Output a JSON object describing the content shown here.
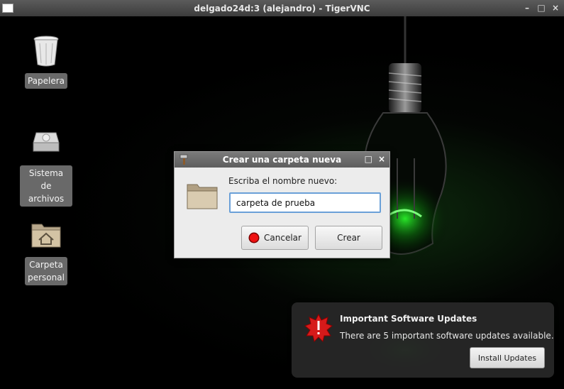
{
  "window": {
    "title": "delgado24d:3 (alejandro) - TigerVNC",
    "buttons": [
      "–",
      "□",
      "×"
    ]
  },
  "desktop_icons": [
    {
      "label": "Papelera",
      "icon": "trash-icon"
    },
    {
      "label": "Sistema de archivos",
      "icon": "drive-icon"
    },
    {
      "label": "Carpeta personal",
      "icon": "home-folder-icon"
    }
  ],
  "dialog": {
    "title": "Crear una carpeta nueva",
    "buttons": [
      "□",
      "×"
    ],
    "prompt": "Escriba el nombre nuevo:",
    "input_value": "carpeta de prueba",
    "cancel_label": "Cancelar",
    "create_label": "Crear"
  },
  "notification": {
    "title": "Important Software Updates",
    "body": "There are 5 important software updates available.",
    "button_label": "Install Updates"
  },
  "colors": {
    "accent_green": "#1fbf1f",
    "input_focus": "#6aa0d8",
    "notification_bg": "#282828"
  }
}
